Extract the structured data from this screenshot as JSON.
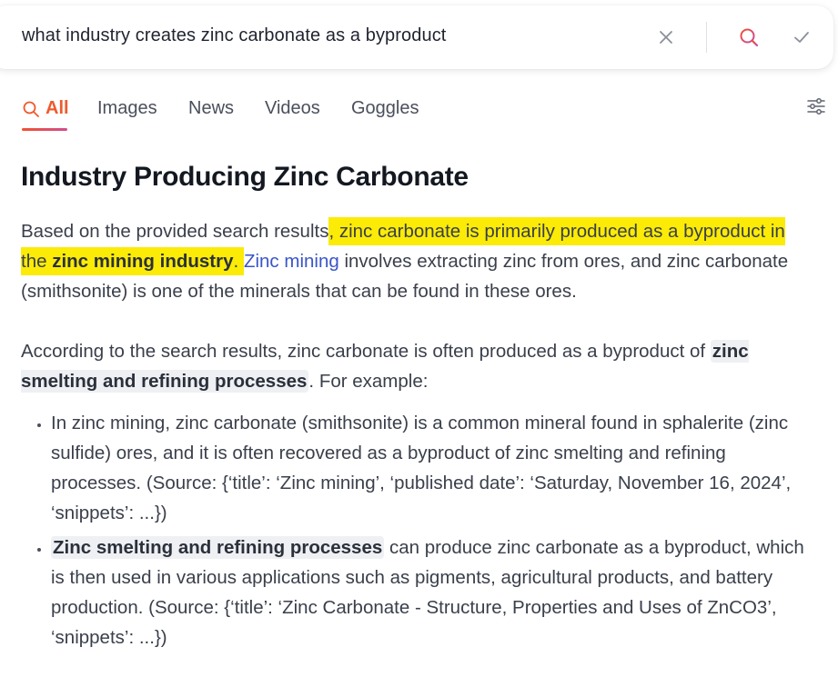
{
  "search": {
    "query": "what industry creates zinc carbonate as a byproduct",
    "clear_icon": "close-icon",
    "search_icon": "search-icon",
    "confirm_icon": "check-icon"
  },
  "tabs": [
    {
      "label": "All",
      "active": true
    },
    {
      "label": "Images"
    },
    {
      "label": "News"
    },
    {
      "label": "Videos"
    },
    {
      "label": "Goggles"
    }
  ],
  "settings_icon": "sliders-icon",
  "colors": {
    "highlight": "#fbeb06",
    "active_tab": "#ef5a2e",
    "link": "#3a55c9",
    "title": "#141821"
  },
  "answer": {
    "title": "Industry Producing Zinc Carbonate",
    "p1": {
      "t1": "Based on the provided search results",
      "t2": ", zinc carbonate is primarily produced as a byproduct in the ",
      "b1": "zinc mining industry",
      "t3": ". ",
      "link": "Zinc mining",
      "t4": " involves extracting zinc from ores, and zinc carbonate (smithsonite) is one of the minerals that can be found in these ores."
    },
    "p2": {
      "t1": "According to the search results, zinc carbonate is often produced as a byproduct of ",
      "chip": "zinc smelting and refining processes",
      "t2": ". For example:"
    },
    "bullets": [
      {
        "t1": "In zinc mining, zinc carbonate (smithsonite) is a common mineral found in sphalerite (zinc sulfide) ores, and it is often recovered as a byproduct of zinc smelting and refining processes. (Source: {‘title’: ‘Zinc mining’, ‘published date’: ‘Saturday, November 16, 2024’, ‘snippets’: ...})"
      },
      {
        "chip": "Zinc smelting and refining processes",
        "t1": " can produce zinc carbonate as a byproduct, which is then used in various applications such as pigments, agricultural products, and battery production. (Source: {‘title’: ‘Zinc Carbonate - Structure, Properties and Uses of ZnCO3’, ‘snippets’: ...})"
      }
    ]
  }
}
